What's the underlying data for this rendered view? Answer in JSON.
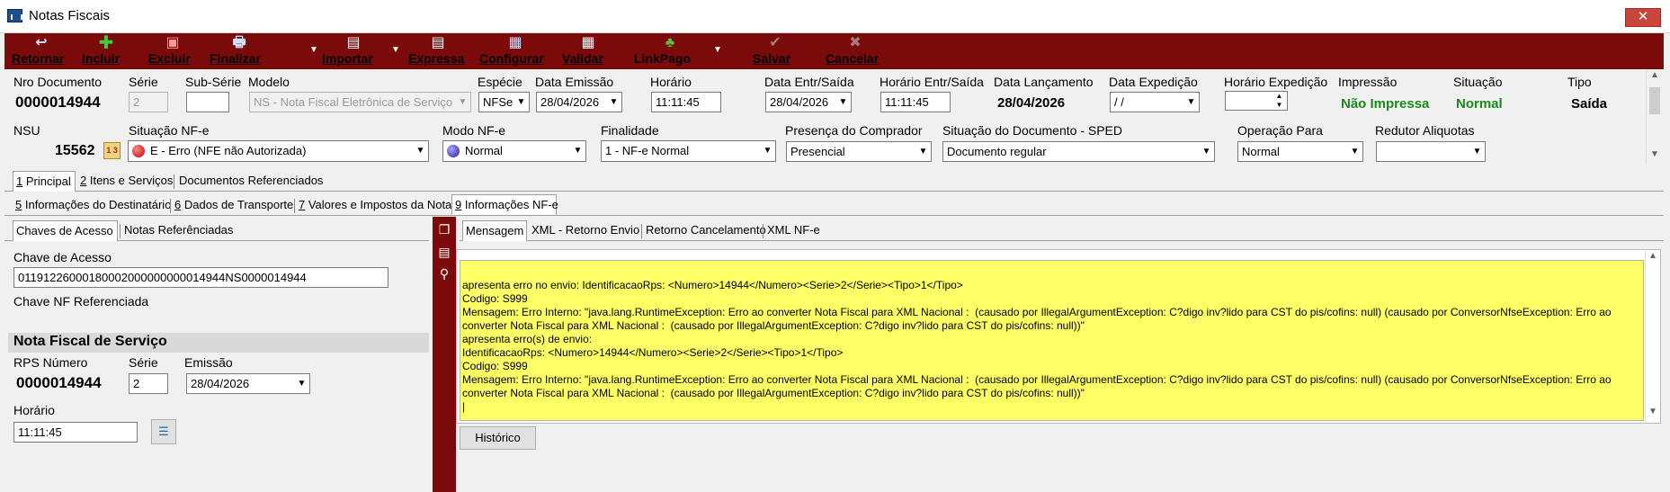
{
  "window": {
    "title": "Notas Fiscais",
    "close_label": "✕"
  },
  "toolbar": {
    "retornar": "Retornar",
    "incluir": "Incluir",
    "excluir": "Excluir",
    "finalizar": "Finalizar",
    "importar": "Importar",
    "expressa": "Expressa",
    "configurar": "Configurar",
    "validar": "Validar",
    "linkpago": "LinkPago",
    "salvar": "Salvar",
    "cancelar": "Cancelar"
  },
  "header": {
    "nro_documento_label": "Nro Documento",
    "nro_documento": "0000014944",
    "serie_label": "Série",
    "serie": "2",
    "subserie_label": "Sub-Série",
    "subserie": "",
    "modelo_label": "Modelo",
    "modelo": "NS - Nota Fiscal Eletrônica de Serviço",
    "especie_label": "Espécie",
    "especie": "NFSe",
    "data_emissao_label": "Data Emissão",
    "data_emissao": "28/04/2026",
    "horario_label": "Horário",
    "horario": "11:11:45",
    "data_entr_saida_label": "Data Entr/Saída",
    "data_entr_saida": "28/04/2026",
    "horario_entr_saida_label": "Horário Entr/Saída",
    "horario_entr_saida": "11:11:45",
    "data_lancamento_label": "Data Lançamento",
    "data_lancamento": "28/04/2026",
    "data_expedicao_label": "Data Expedição",
    "data_expedicao": " / /",
    "horario_expedicao_label": "Horário Expedição",
    "horario_expedicao": "",
    "impressao_label": "Impressão",
    "impressao": "Não Impressa",
    "situacao_label": "Situação",
    "situacao": "Normal",
    "tipo_label": "Tipo",
    "tipo": "Saída",
    "nsu_label": "NSU",
    "nsu": "15562",
    "situacao_nfe_label": "Situação NF-e",
    "situacao_nfe": "E - Erro (NFE não Autorizada)",
    "modo_nfe_label": "Modo NF-e",
    "modo_nfe": "Normal",
    "finalidade_label": "Finalidade",
    "finalidade": "1 - NF-e Normal",
    "presenca_label": "Presença do Comprador",
    "presenca": "Presencial",
    "situacao_sped_label": "Situação do Documento - SPED",
    "situacao_sped": "Documento regular",
    "operacao_label": "Operação Para",
    "operacao": "Normal",
    "redutor_label": "Redutor Aliquotas",
    "redutor": ""
  },
  "tabs_row1": [
    {
      "key": "1",
      "rest": " Principal"
    },
    {
      "key": "2",
      "rest": " Itens e Serviços"
    },
    {
      "key": "",
      "rest": "Documentos Referenciados"
    }
  ],
  "tabs_row2": [
    {
      "key": "5",
      "rest": " Informações do Destinatário"
    },
    {
      "key": "6",
      "rest": " Dados de Transporte"
    },
    {
      "key": "7",
      "rest": " Valores e Impostos da Nota"
    },
    {
      "key": "9",
      "rest": " Informações NF-e"
    }
  ],
  "left_tabs": {
    "chaves": "Chaves de Acesso",
    "notas": "Notas Referênciadas"
  },
  "chave": {
    "label": "Chave de Acesso",
    "value": "01191226000180002000000000014944NS0000014944",
    "ref_label": "Chave NF Referenciada"
  },
  "nfs": {
    "section_title": "Nota Fiscal de Serviço",
    "rps_label": "RPS Número",
    "rps": "0000014944",
    "serie_label": "Série",
    "serie": "2",
    "emissao_label": "Emissão",
    "emissao": "28/04/2026",
    "horario_label": "Horário",
    "horario": "11:11:45"
  },
  "right_tabs": {
    "mensagem": "Mensagem",
    "xml_retorno": "XML - Retorno Envio",
    "retorno_cancel": "Retorno Cancelamento",
    "xml_nfe": "XML NF-e"
  },
  "message": "apresenta erro no envio: IdentificacaoRps: <Numero>14944</Numero><Serie>2</Serie><Tipo>1</Tipo>\nCodigo: S999\nMensagem: Erro Interno: \"java.lang.RuntimeException: Erro ao converter Nota Fiscal para XML Nacional :  (causado por IllegalArgumentException: C?digo inv?lido para CST do pis/cofins: null) (causado por ConversorNfseException: Erro ao\nconverter Nota Fiscal para XML Nacional :  (causado por IllegalArgumentException: C?digo inv?lido para CST do pis/cofins: null))\"\napresenta erro(s) de envio:\nIdentificacaoRps: <Numero>14944</Numero><Serie>2</Serie><Tipo>1</Tipo>\nCodigo: S999\nMensagem: Erro Interno: \"java.lang.RuntimeException: Erro ao converter Nota Fiscal para XML Nacional :  (causado por IllegalArgumentException: C?digo inv?lido para CST do pis/cofins: null) (causado por ConversorNfseException: Erro ao\nconverter Nota Fiscal para XML Nacional :  (causado por IllegalArgumentException: C?digo inv?lido para CST do pis/cofins: null))\"\n|",
  "historico_label": "Histórico",
  "colors": {
    "toolbar": "#7b0a0a",
    "message_bg": "#ffff66",
    "status_green": "#1a8a1a"
  }
}
